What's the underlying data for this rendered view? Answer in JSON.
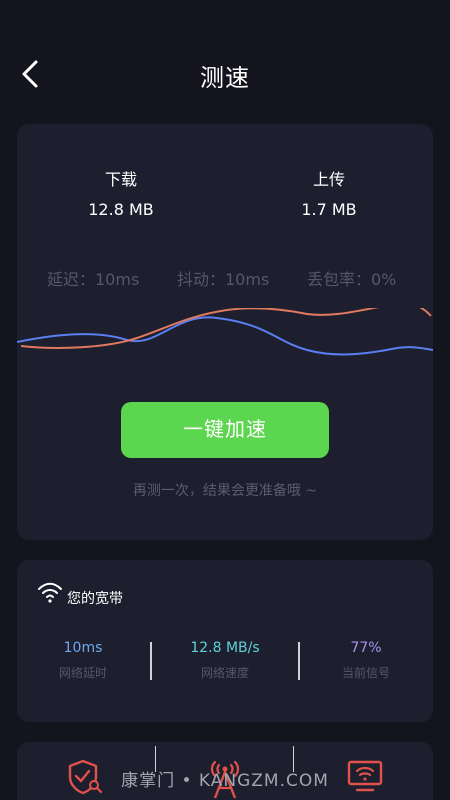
{
  "header": {
    "title": "测速"
  },
  "speed_card": {
    "download_label": "下载",
    "download_value": "12.8 MB",
    "upload_label": "上传",
    "upload_value": "1.7 MB",
    "latency": "延迟：10ms",
    "jitter": "抖动：10ms",
    "packet_loss": "丢包率：0%",
    "accelerate_button": "一键加速",
    "hint": "再测一次，结果会更准备哦 ~"
  },
  "broadband": {
    "title": "您的宽带",
    "stats": [
      {
        "value": "10ms",
        "label": "网络延时",
        "color": "#6fa8ef"
      },
      {
        "value": "12.8 MB/s",
        "label": "网络速度",
        "color": "#5ed2d8"
      },
      {
        "value": "77%",
        "label": "当前信号",
        "color": "#a692f0"
      }
    ]
  },
  "bottom_bar": {
    "icons": [
      "shield-search-icon",
      "signal-tower-icon",
      "screen-cast-icon"
    ]
  },
  "watermark": "康掌门 • KANGZM.COM",
  "colors": {
    "accent_green": "#5cd64e",
    "wave_orange": "#e07a5f",
    "wave_blue": "#5b7ff0",
    "icon_red": "#e0524a",
    "background": "#14141f",
    "card": "#1d1e2e"
  }
}
